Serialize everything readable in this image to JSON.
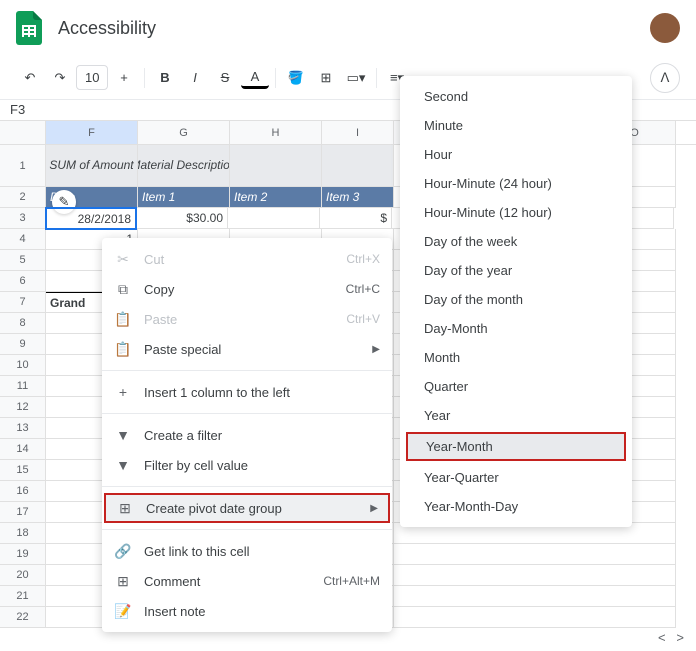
{
  "header": {
    "doc_title": "Accessibility"
  },
  "toolbar": {
    "font_size": "10"
  },
  "namebox": "F3",
  "columns": [
    "F",
    "G",
    "H",
    "I",
    "O"
  ],
  "row_numbers": [
    "1",
    "2",
    "3",
    "4",
    "5",
    "6",
    "7",
    "8",
    "9",
    "10",
    "11",
    "12",
    "13",
    "14",
    "15",
    "16",
    "17",
    "18",
    "19",
    "20",
    "21",
    "22"
  ],
  "cells": {
    "F1": "SUM of Amount",
    "G1": "Material Description",
    "F2": "Date",
    "G2": "Item 1",
    "H2": "Item 2",
    "I2": "Item 3",
    "F3": "28/2/2018",
    "G3": "$30.00",
    "I3": "$",
    "F4": "1",
    "F7": "Grand"
  },
  "context_menu": [
    {
      "icon": "✂",
      "label": "Cut",
      "shortcut": "Ctrl+X",
      "disabled": true
    },
    {
      "icon": "⧉",
      "label": "Copy",
      "shortcut": "Ctrl+C"
    },
    {
      "icon": "📋",
      "label": "Paste",
      "shortcut": "Ctrl+V",
      "disabled": true
    },
    {
      "icon": "📋",
      "label": "Paste special",
      "arrow": true
    },
    {
      "sep": true
    },
    {
      "icon": "+",
      "label": "Insert 1 column to the left"
    },
    {
      "sep": true
    },
    {
      "icon": "▼",
      "label": "Create a filter"
    },
    {
      "icon": "▼",
      "label": "Filter by cell value"
    },
    {
      "sep": true
    },
    {
      "icon": "⊞",
      "label": "Create pivot date group",
      "arrow": true,
      "highlight": true
    },
    {
      "sep": true
    },
    {
      "icon": "🔗",
      "label": "Get link to this cell"
    },
    {
      "icon": "⊞",
      "label": "Comment",
      "shortcut": "Ctrl+Alt+M"
    },
    {
      "icon": "📝",
      "label": "Insert note"
    }
  ],
  "submenu": [
    "Second",
    "Minute",
    "Hour",
    "Hour-Minute (24 hour)",
    "Hour-Minute (12 hour)",
    "Day of the week",
    "Day of the year",
    "Day of the month",
    "Day-Month",
    "Month",
    "Quarter",
    "Year",
    "Year-Month",
    "Year-Quarter",
    "Year-Month-Day"
  ],
  "submenu_highlight": "Year-Month"
}
